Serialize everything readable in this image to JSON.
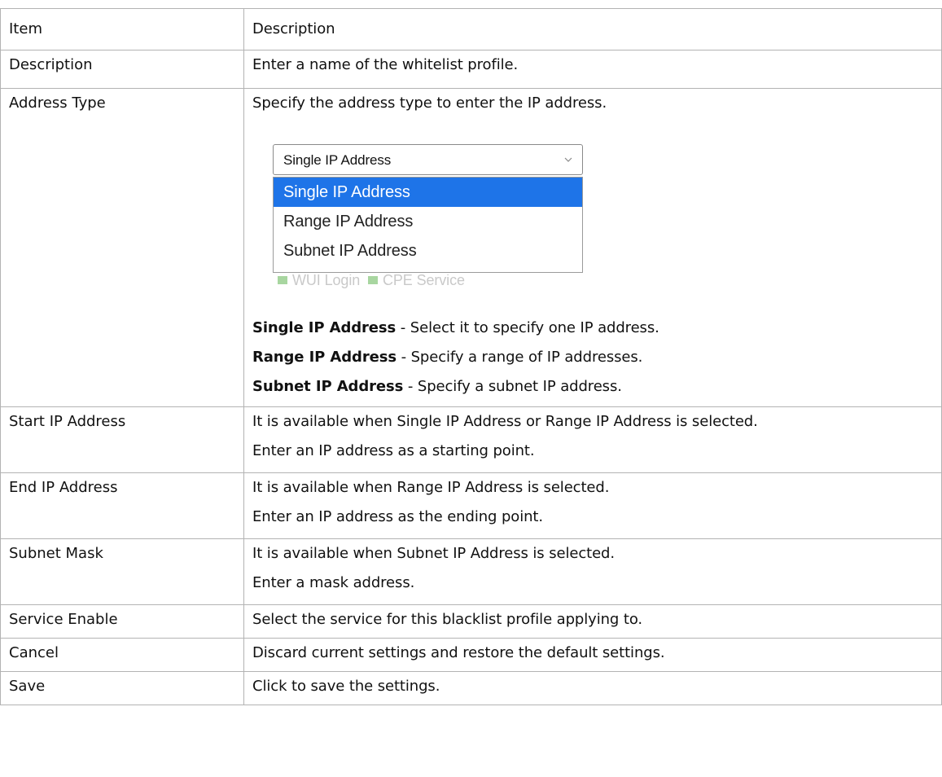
{
  "header": {
    "item": "Item",
    "description": "Description"
  },
  "rows": [
    {
      "item": "Description",
      "lines": [
        "Enter a name of the whitelist profile."
      ]
    },
    {
      "item": "Address Type",
      "lines": [
        "Specify the address type to enter the IP address."
      ]
    },
    {
      "item": "Start IP Address",
      "lines": [
        "It is available when Single IP Address or Range IP Address is selected.",
        "Enter an IP address as a starting point."
      ]
    },
    {
      "item": "End IP Address",
      "lines": [
        "It is available when Range IP Address is selected.",
        "Enter an IP address as the ending point."
      ]
    },
    {
      "item": "Subnet Mask",
      "lines": [
        "It is available when Subnet IP Address is selected.",
        "Enter a mask address."
      ]
    },
    {
      "item": "Service Enable",
      "lines": [
        "Select the service for this blacklist profile applying to."
      ]
    },
    {
      "item": "Cancel",
      "lines": [
        "Discard current settings and restore the default settings."
      ]
    },
    {
      "item": "Save",
      "lines": [
        "Click to save the settings."
      ]
    }
  ],
  "address_type_figure": {
    "select_value": "Single IP Address",
    "options": [
      "Single IP Address",
      "Range IP Address",
      "Subnet IP Address"
    ],
    "selected_index": 0,
    "ghost_labels": [
      "WUI Login",
      "CPE Service"
    ]
  },
  "option_descriptions": [
    {
      "term": "Single IP Address",
      "text": " - Select it to specify one IP address."
    },
    {
      "term": "Range IP Address",
      "text": " - Specify a range of IP addresses."
    },
    {
      "term": "Subnet IP Address",
      "text": " - Specify a subnet IP address."
    }
  ],
  "colors": {
    "border": "#b3b3b3",
    "selected_option": "#1e74e8"
  },
  "icons": {
    "select_arrow": "chevron-down-icon"
  }
}
